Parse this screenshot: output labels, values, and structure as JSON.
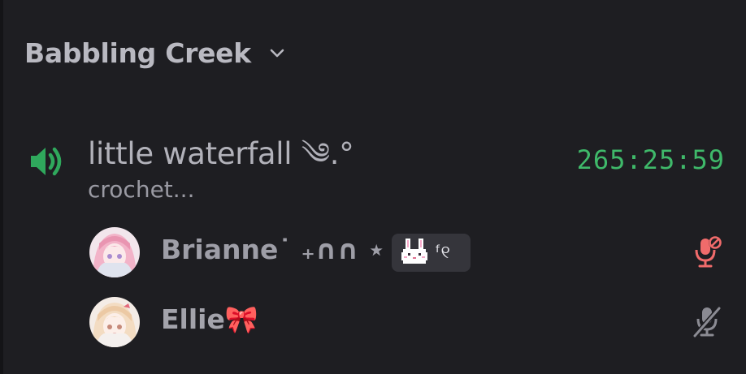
{
  "category": {
    "name": "Babbling Creek",
    "chevron_icon": "chevron-down-icon"
  },
  "channel": {
    "icon": "speaker-icon",
    "name": "little waterfall ༄.°",
    "status": "crochet...",
    "timer": "265:25:59",
    "speaker_color": "#2fa85c",
    "timer_color": "#3fb96a"
  },
  "users": [
    {
      "name": "Brianne˙ ₊∩∩ ⋆",
      "tag_icon": "bunny-icon",
      "tag_text": "ᶠ୧",
      "voice_state": "server-muted",
      "voice_icon": "mic-muted-icon",
      "voice_icon_color": "#f06b6b"
    },
    {
      "name": "Ellie🎀",
      "voice_state": "self-muted",
      "voice_icon": "mic-off-icon",
      "voice_icon_color": "#8b8b93"
    }
  ]
}
